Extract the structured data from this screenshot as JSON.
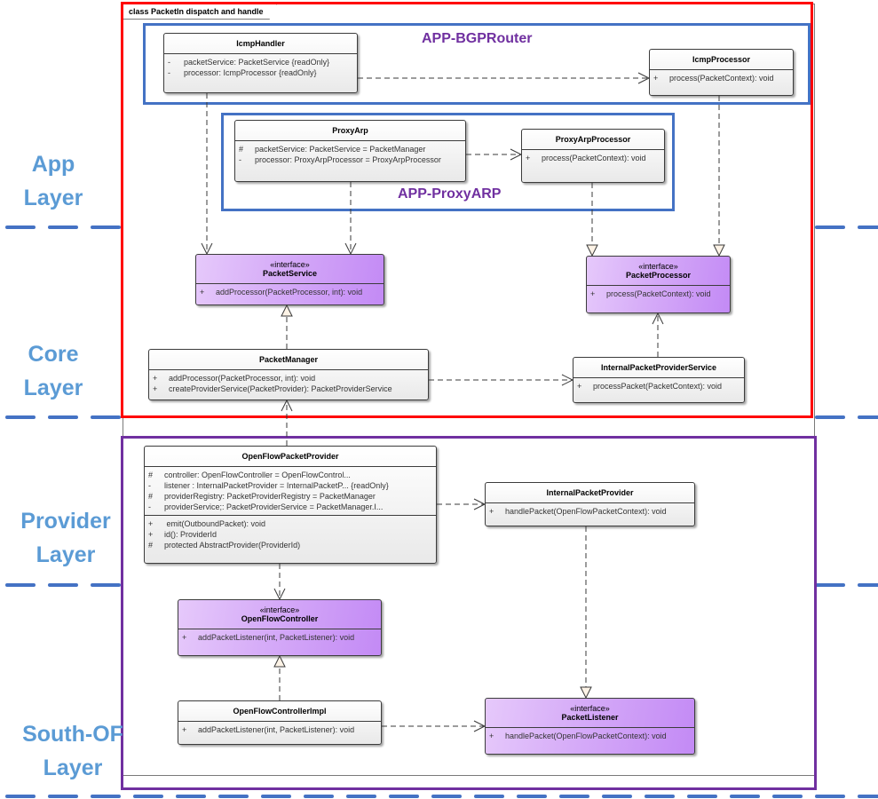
{
  "diagram": {
    "frame_title": "class PacketIn dispatch and handle",
    "layers": [
      {
        "id": "app",
        "line1": "App",
        "line2": "Layer"
      },
      {
        "id": "core",
        "line1": "Core",
        "line2": "Layer"
      },
      {
        "id": "provider",
        "line1": "Provider",
        "line2": "Layer"
      },
      {
        "id": "south",
        "line1": "South-OF",
        "line2": "Layer"
      }
    ],
    "packages": [
      {
        "id": "bgp",
        "label": "APP-BGPRouter"
      },
      {
        "id": "proxyarp",
        "label": "APP-ProxyARP"
      }
    ],
    "colors": {
      "core_boundary": "#ff0000",
      "provider_boundary": "#7030a0",
      "package_border": "#4472c4",
      "package_label": "#7030a0",
      "layer_label": "#5b9bd5",
      "layer_divider": "#4472c4",
      "interface_fill": "#d7aef8",
      "class_fill": "#f0f0f0"
    },
    "classes": {
      "IcmpHandler": {
        "name": "IcmpHandler",
        "stereotype": null,
        "attributes": [
          {
            "vis": "-",
            "text": "packetService: PacketService  {readOnly}"
          },
          {
            "vis": "-",
            "text": "processor: IcmpProcessor {readOnly}"
          }
        ],
        "operations": []
      },
      "IcmpProcessor": {
        "name": "IcmpProcessor",
        "stereotype": null,
        "attributes": [],
        "operations": [
          {
            "vis": "+",
            "text": "process(PacketContext): void"
          }
        ]
      },
      "ProxyArp": {
        "name": "ProxyArp",
        "stereotype": null,
        "attributes": [
          {
            "vis": "#",
            "text": "packetService: PacketService  = PacketManager"
          },
          {
            "vis": "-",
            "text": "processor: ProxyArpProcessor = ProxyArpProcessor"
          }
        ],
        "operations": []
      },
      "ProxyArpProcessor": {
        "name": "ProxyArpProcessor",
        "stereotype": null,
        "attributes": [],
        "operations": [
          {
            "vis": "+",
            "text": "process(PacketContext): void"
          }
        ]
      },
      "PacketService": {
        "name": "PacketService",
        "stereotype": "«interface»",
        "attributes": [],
        "operations": [
          {
            "vis": "+",
            "text": "addProcessor(PacketProcessor, int): void"
          }
        ]
      },
      "PacketProcessor": {
        "name": "PacketProcessor",
        "stereotype": "«interface»",
        "attributes": [],
        "operations": [
          {
            "vis": "+",
            "text": "process(PacketContext): void"
          }
        ]
      },
      "PacketManager": {
        "name": "PacketManager",
        "stereotype": null,
        "attributes": [],
        "operations": [
          {
            "vis": "+",
            "text": "addProcessor(PacketProcessor, int): void"
          },
          {
            "vis": "+",
            "text": "createProviderService(PacketProvider): PacketProviderService"
          }
        ]
      },
      "InternalPacketProviderService": {
        "name": "InternalPacketProviderService",
        "stereotype": null,
        "attributes": [],
        "operations": [
          {
            "vis": "+",
            "text": "processPacket(PacketContext): void"
          }
        ]
      },
      "OpenFlowPacketProvider": {
        "name": "OpenFlowPacketProvider",
        "stereotype": null,
        "attributes": [
          {
            "vis": "#",
            "text": "controller: OpenFlowController = OpenFlowControl..."
          },
          {
            "vis": "-",
            "text": "listener : InternalPacketProvider = InternalPacketP... {readOnly}"
          },
          {
            "vis": "#",
            "text": "providerRegistry: PacketProviderRegistry  = PacketManager"
          },
          {
            "vis": "-",
            "text": "providerService;: PacketProviderService  = PacketManager.I..."
          }
        ],
        "operations": [
          {
            "vis": "+",
            "text": " emit(OutboundPacket): void"
          },
          {
            "vis": "+",
            "text": "id(): ProviderId"
          },
          {
            "vis": "#",
            "text": "protected AbstractProvider(ProviderId)"
          }
        ]
      },
      "InternalPacketProvider": {
        "name": "InternalPacketProvider",
        "stereotype": null,
        "attributes": [],
        "operations": [
          {
            "vis": "+",
            "text": "handlePacket(OpenFlowPacketContext): void"
          }
        ]
      },
      "OpenFlowController": {
        "name": "OpenFlowController",
        "stereotype": "«interface»",
        "attributes": [],
        "operations": [
          {
            "vis": "+",
            "text": "addPacketListener(int, PacketListener): void"
          }
        ]
      },
      "OpenFlowControllerImpl": {
        "name": "OpenFlowControllerImpl",
        "stereotype": null,
        "attributes": [],
        "operations": [
          {
            "vis": "+",
            "text": "addPacketListener(int, PacketListener): void"
          }
        ]
      },
      "PacketListener": {
        "name": "PacketListener",
        "stereotype": "«interface»",
        "attributes": [],
        "operations": [
          {
            "vis": "+",
            "text": "handlePacket(OpenFlowPacketContext): void"
          }
        ]
      }
    },
    "relations": [
      {
        "from": "IcmpHandler",
        "to": "IcmpProcessor",
        "type": "dependency"
      },
      {
        "from": "IcmpHandler",
        "to": "PacketService",
        "type": "dependency"
      },
      {
        "from": "IcmpProcessor",
        "to": "PacketProcessor",
        "type": "realization"
      },
      {
        "from": "ProxyArp",
        "to": "ProxyArpProcessor",
        "type": "dependency"
      },
      {
        "from": "ProxyArp",
        "to": "PacketService",
        "type": "dependency"
      },
      {
        "from": "ProxyArpProcessor",
        "to": "PacketProcessor",
        "type": "realization"
      },
      {
        "from": "PacketManager",
        "to": "PacketService",
        "type": "realization"
      },
      {
        "from": "PacketManager",
        "to": "InternalPacketProviderService",
        "type": "dependency"
      },
      {
        "from": "InternalPacketProviderService",
        "to": "PacketProcessor",
        "type": "dependency"
      },
      {
        "from": "OpenFlowPacketProvider",
        "to": "PacketManager",
        "type": "dependency"
      },
      {
        "from": "OpenFlowPacketProvider",
        "to": "InternalPacketProvider",
        "type": "dependency"
      },
      {
        "from": "OpenFlowPacketProvider",
        "to": "OpenFlowController",
        "type": "dependency"
      },
      {
        "from": "InternalPacketProvider",
        "to": "PacketListener",
        "type": "realization"
      },
      {
        "from": "OpenFlowControllerImpl",
        "to": "OpenFlowController",
        "type": "realization"
      },
      {
        "from": "OpenFlowControllerImpl",
        "to": "PacketListener",
        "type": "dependency"
      }
    ]
  }
}
